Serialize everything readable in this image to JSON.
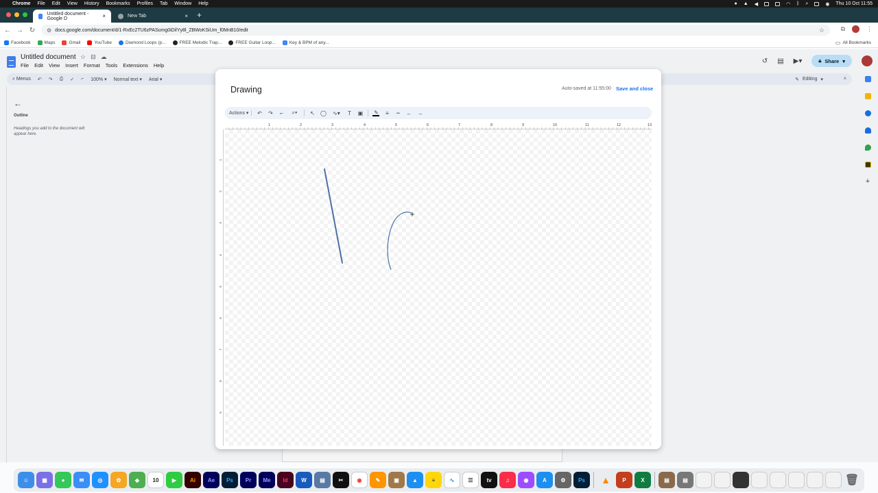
{
  "menubar": {
    "app": "Chrome",
    "items": [
      "File",
      "Edit",
      "View",
      "History",
      "Bookmarks",
      "Profiles",
      "Tab",
      "Window",
      "Help"
    ],
    "datetime": "Thu 10 Oct 11:55"
  },
  "tabs": [
    {
      "label": "Untitled document - Google D",
      "active": true
    },
    {
      "label": "New Tab",
      "active": false
    }
  ],
  "address": {
    "url": "docs.google.com/document/d/1-RxEc2TU6zPASumg0iDilYy8l_ZBWoKSiUm_f0MnB10/edit"
  },
  "bookmarks": {
    "items": [
      "Facebook",
      "Maps",
      "Gmail",
      "YouTube",
      "Diamond Loops (p...",
      "FREE Melodic Trap...",
      "FREE Guitar Loop...",
      "Key & BPM of any..."
    ],
    "colors": [
      "#1877f2",
      "#34a853",
      "#ea4335",
      "#ff0000",
      "#1a73e8",
      "#222222",
      "#222222",
      "#4285f4"
    ],
    "all_label": "All Bookmarks"
  },
  "doc": {
    "title": "Untitled document",
    "menu": [
      "File",
      "Edit",
      "View",
      "Insert",
      "Format",
      "Tools",
      "Extensions",
      "Help"
    ],
    "share_label": "Share",
    "toolbar": {
      "menus": "Menus",
      "zoom": "100%",
      "style": "Normal text",
      "font": "Arial",
      "mode": "Editing"
    }
  },
  "outline": {
    "title": "Outline",
    "hint": "Headings you add to the document will appear here."
  },
  "dialog": {
    "title": "Drawing",
    "autosave": "Auto-saved at 11:55:00",
    "save_close": "Save and close",
    "actions_label": "Actions",
    "ruler_numbers": [
      "1",
      "2",
      "3",
      "4",
      "5",
      "6",
      "7",
      "8",
      "9",
      "10",
      "11",
      "12",
      "13"
    ],
    "vruler_numbers": [
      "1",
      "2",
      "3",
      "4",
      "5",
      "6",
      "7",
      "8",
      "9"
    ],
    "stroke_color": "#4a6fa5"
  },
  "dock": {
    "apps": [
      "Finder",
      "Launchpad",
      "Messages",
      "Mail",
      "Safari",
      "Photos",
      "Maps",
      "Calendar",
      "FaceTime",
      "Illustrator",
      "After Effects",
      "Photoshop",
      "Premiere Pro",
      "Media Encoder",
      "InDesign",
      "Word",
      "Preview",
      "CapCut",
      "Chrome",
      "Pages",
      "Keka",
      "Keynote",
      "Notes",
      "Freeform",
      "Reminders",
      "TV",
      "Music",
      "Podcasts",
      "App Store",
      "System Settings",
      "Photoshop",
      "VLC",
      "PowerPoint",
      "Excel"
    ],
    "calendar_day": "10"
  }
}
